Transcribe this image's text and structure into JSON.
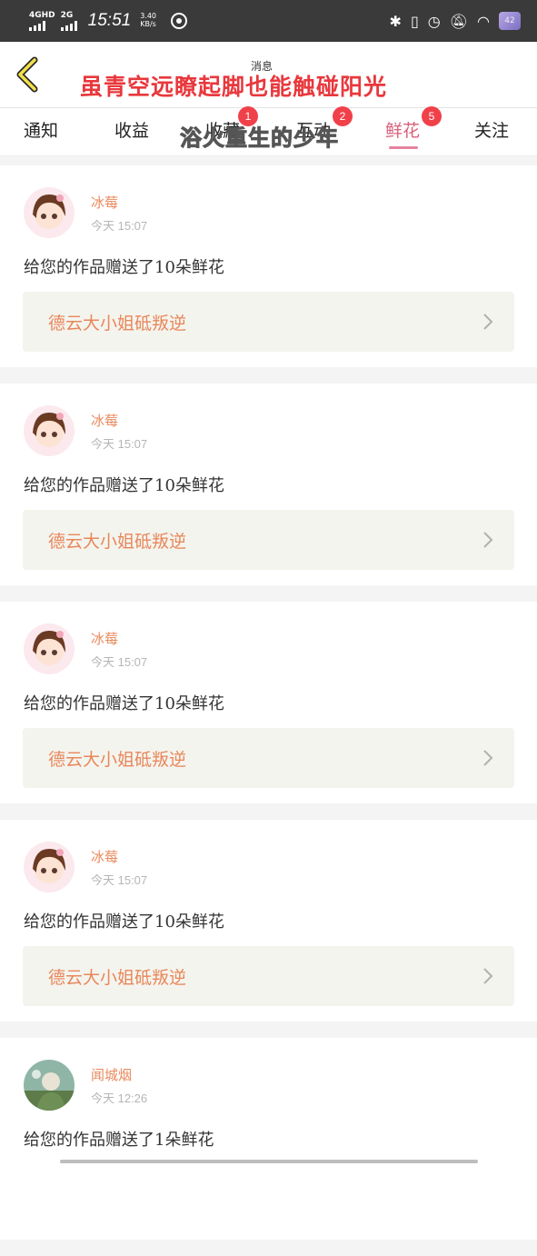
{
  "status_bar": {
    "sim1": "4GHD",
    "sim2": "2G",
    "time": "15:51",
    "speed_value": "3.40",
    "speed_unit": "KB/s",
    "battery": "42"
  },
  "header": {
    "banner": "虽青空远瞭起脚也能触碰阳光",
    "deco_small": "消息"
  },
  "tabs": [
    {
      "label": "通知",
      "badge": ""
    },
    {
      "label": "收益",
      "badge": ""
    },
    {
      "label": "收藏",
      "badge": "1"
    },
    {
      "label": "互动",
      "badge": "2"
    },
    {
      "label": "鲜花",
      "badge": "5",
      "active": true
    },
    {
      "label": "关注",
      "badge": ""
    }
  ],
  "overlay_text": "浴火重生的少年",
  "items": [
    {
      "name": "冰莓",
      "time": "今天 15:07",
      "message": "给您的作品赠送了10朵鲜花",
      "work": "德云大小姐砥叛逆",
      "avatar": "anime-girl-avatar"
    },
    {
      "name": "冰莓",
      "time": "今天 15:07",
      "message": "给您的作品赠送了10朵鲜花",
      "work": "德云大小姐砥叛逆",
      "avatar": "anime-girl-avatar"
    },
    {
      "name": "冰莓",
      "time": "今天 15:07",
      "message": "给您的作品赠送了10朵鲜花",
      "work": "德云大小姐砥叛逆",
      "avatar": "anime-girl-avatar"
    },
    {
      "name": "冰莓",
      "time": "今天 15:07",
      "message": "给您的作品赠送了10朵鲜花",
      "work": "德云大小姐砥叛逆",
      "avatar": "anime-girl-avatar"
    },
    {
      "name": "闻城烟",
      "time": "今天 12:26",
      "message": "给您的作品赠送了1朵鲜花",
      "work": "",
      "avatar": "landscape-avatar"
    }
  ],
  "colors": {
    "accent": "#d9607a",
    "name": "#e88a5e",
    "banner": "#e8383d",
    "badge": "#f0414a"
  }
}
